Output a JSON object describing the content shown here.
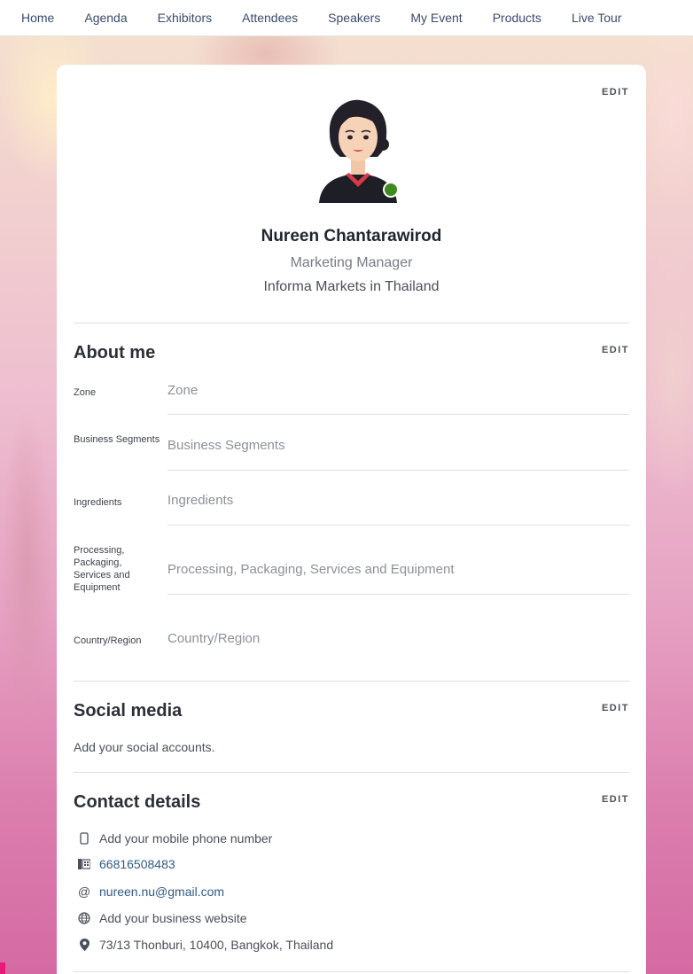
{
  "nav": {
    "items": [
      "Home",
      "Agenda",
      "Exhibitors",
      "Attendees",
      "Speakers",
      "My Event",
      "Products",
      "Live Tour"
    ]
  },
  "profile": {
    "edit_label": "EDIT",
    "name": "Nureen Chantarawirod",
    "job_title": "Marketing Manager",
    "company": "Informa Markets in Thailand",
    "online_status_color": "#3f8a1f"
  },
  "about": {
    "title": "About me",
    "edit_label": "EDIT",
    "fields": [
      {
        "label": "Zone",
        "placeholder": "Zone"
      },
      {
        "label": "Business Segments",
        "placeholder": "Business Segments"
      },
      {
        "label": "Ingredients",
        "placeholder": "Ingredients"
      },
      {
        "label": "Processing, Packaging, Services and Equipment",
        "placeholder": "Processing, Packaging, Services and Equipment"
      },
      {
        "label": "Country/Region",
        "placeholder": "Country/Region"
      }
    ]
  },
  "social": {
    "title": "Social media",
    "edit_label": "EDIT",
    "text": "Add your social accounts."
  },
  "contact": {
    "title": "Contact details",
    "edit_label": "EDIT",
    "rows": [
      {
        "icon": "mobile-phone-icon",
        "text": "Add your mobile phone number"
      },
      {
        "icon": "office-phone-icon",
        "text": "66816508483"
      },
      {
        "icon": "at-email-icon",
        "text": "nureen.nu@gmail.com"
      },
      {
        "icon": "website-globe-icon",
        "text": "Add your business website"
      },
      {
        "icon": "location-pin-icon",
        "text": "73/13 Thonburi, 10400, Bangkok, Thailand"
      }
    ]
  }
}
